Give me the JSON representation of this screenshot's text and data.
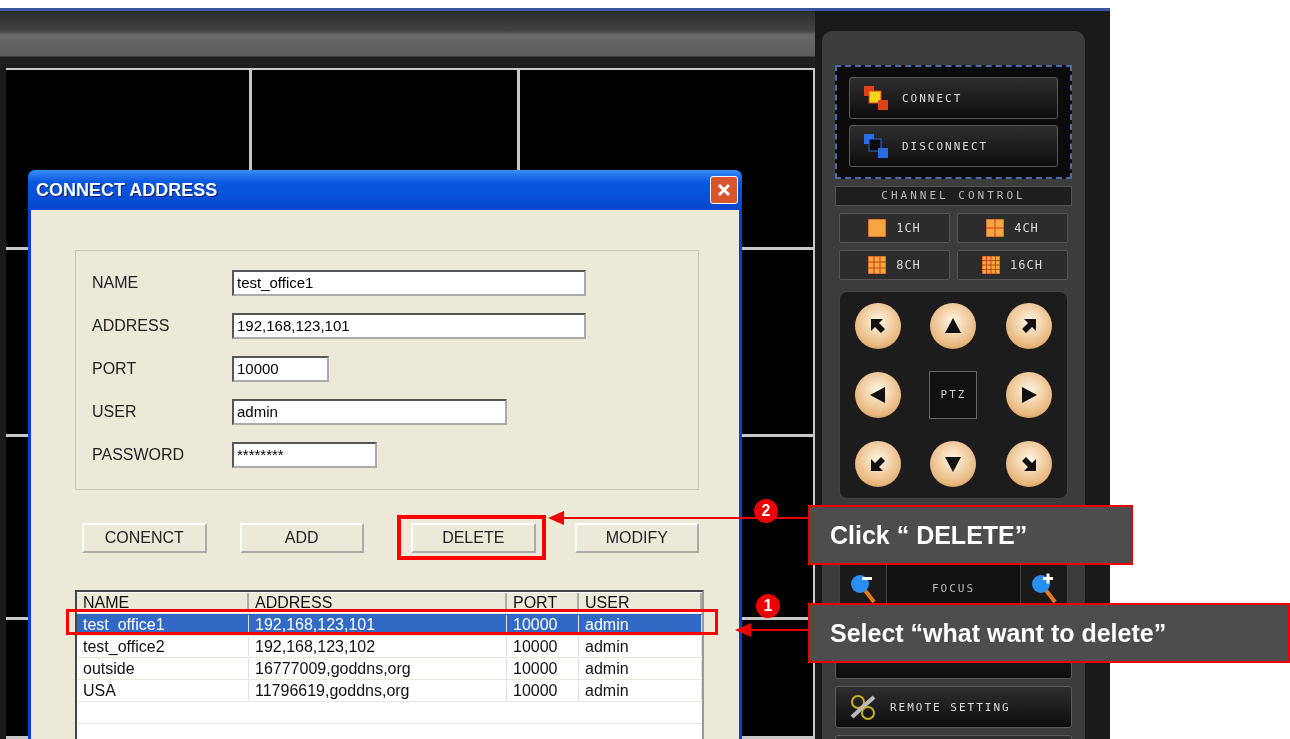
{
  "dialog": {
    "title": "CONNECT ADDRESS",
    "fields": [
      {
        "label": "NAME",
        "value": "test_office1"
      },
      {
        "label": "ADDRESS",
        "value": "192,168,123,101"
      },
      {
        "label": "PORT",
        "value": "10000"
      },
      {
        "label": "USER",
        "value": "admin"
      },
      {
        "label": "PASSWORD",
        "value": "********"
      }
    ],
    "buttons": [
      {
        "label": "CONENCT"
      },
      {
        "label": "ADD"
      },
      {
        "label": "DELETE"
      },
      {
        "label": "MODIFY"
      }
    ],
    "table": {
      "columns": [
        "NAME",
        "ADDRESS",
        "PORT",
        "USER"
      ],
      "rows": [
        {
          "cells": [
            "test_office1",
            "192,168,123,101",
            "10000",
            "admin"
          ],
          "selected": true
        },
        {
          "cells": [
            "test_office2",
            "192,168,123,102",
            "10000",
            "admin"
          ],
          "selected": false
        },
        {
          "cells": [
            "outside",
            "16777009,goddns,org",
            "10000",
            "admin"
          ],
          "selected": false
        },
        {
          "cells": [
            "USA",
            "11796619,goddns,org",
            "10000",
            "admin"
          ],
          "selected": false
        }
      ]
    }
  },
  "panel": {
    "connection_buttons": [
      {
        "label": "CONNECT",
        "kind": "connect"
      },
      {
        "label": "DISCONNECT",
        "kind": "disconnect"
      }
    ],
    "channel_control": {
      "title": "CHANNEL CONTROL",
      "buttons": [
        {
          "label": "1CH"
        },
        {
          "label": "4CH"
        },
        {
          "label": "8CH"
        },
        {
          "label": "16CH"
        }
      ]
    },
    "ptz": {
      "label": "PTZ"
    },
    "focus": {
      "label": "FOCUS"
    },
    "remote_setting": {
      "label": "REMOTE SETTING"
    }
  },
  "callouts": [
    {
      "number": "2",
      "text": "Click “ DELETE”"
    },
    {
      "number": "1",
      "text": "Select “what want to delete”"
    }
  ]
}
